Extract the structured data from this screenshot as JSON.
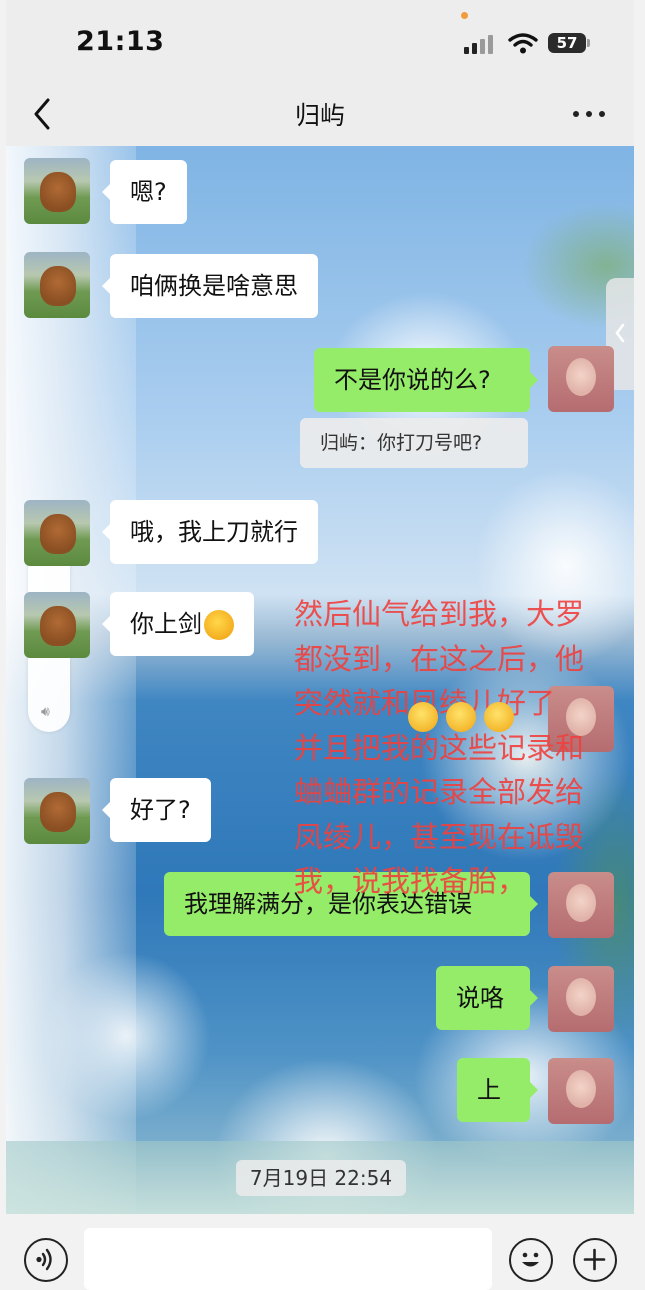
{
  "status_bar": {
    "time": "21:13",
    "battery": "57"
  },
  "header": {
    "title": "归屿"
  },
  "messages": [
    {
      "side": "in",
      "text": "嗯?"
    },
    {
      "side": "in",
      "text": "咱俩换是啥意思"
    },
    {
      "side": "out",
      "text": "不是你说的么?"
    },
    {
      "side": "in",
      "text": "哦，我上刀就行"
    },
    {
      "side": "in",
      "text": "你上剑"
    },
    {
      "side": "in",
      "text": "好了?"
    },
    {
      "side": "out",
      "text": "我理解满分，是你表达错误"
    },
    {
      "side": "out",
      "text": "说咯"
    },
    {
      "side": "out",
      "text": "上"
    }
  ],
  "quote": {
    "text": "归屿：你打刀号吧?"
  },
  "overlay_text": {
    "lines": [
      "然后仙气给到我，大罗",
      "都没到，在这之后，他",
      "突然就和凤绫儿好了",
      "并且把我的这些记录和",
      "蛐蛐群的记录全部发给",
      "凤绫儿，甚至现在诋毁",
      "我，说我找备胎，"
    ],
    "color": "#f0413e"
  },
  "timestamp": "7月19日 22:54",
  "colors": {
    "out_bubble": "#95ec69",
    "in_bubble": "#ffffff",
    "bar_bg": "#ededed"
  },
  "icons": {
    "back": "chevron-left-icon",
    "more": "more-dots-icon",
    "voice": "voice-icon",
    "emoji": "smiley-icon",
    "add": "plus-icon"
  }
}
